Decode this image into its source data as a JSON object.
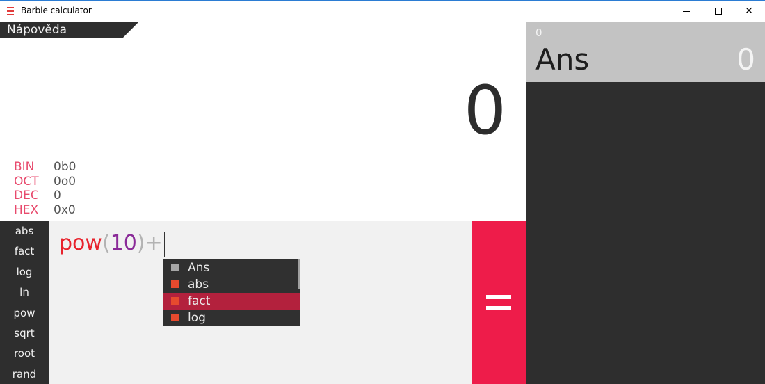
{
  "window": {
    "title": "Barbie calculator",
    "close_glyph": "✕"
  },
  "help": {
    "label": "Nápověda"
  },
  "result": {
    "value": "0"
  },
  "bases": [
    {
      "name": "BIN",
      "value": "0b0"
    },
    {
      "name": "OCT",
      "value": "0o0"
    },
    {
      "name": "DEC",
      "value": "0"
    },
    {
      "name": "HEX",
      "value": "0x0"
    }
  ],
  "history": {
    "items": [
      {
        "index": "0",
        "name": "Ans",
        "value": "0"
      }
    ]
  },
  "functions": [
    "abs",
    "fact",
    "log",
    "ln",
    "pow",
    "sqrt",
    "root",
    "rand"
  ],
  "expression": {
    "func": "pow",
    "open": "(",
    "number": "10",
    "close": ")",
    "op": "+"
  },
  "autocomplete": {
    "items": [
      {
        "label": "Ans",
        "color": "#a6a6a6"
      },
      {
        "label": "abs",
        "color": "#e64a2e"
      },
      {
        "label": "fact",
        "color": "#e64a2e"
      },
      {
        "label": "log",
        "color": "#e64a2e"
      }
    ],
    "selected_index": 2
  },
  "colors": {
    "accent": "#ee1c4a",
    "base_label": "#e84a6d",
    "panel_dark": "#2e2e2e",
    "history_item": "#c3c3c3",
    "ac_selected": "#b3213d"
  }
}
